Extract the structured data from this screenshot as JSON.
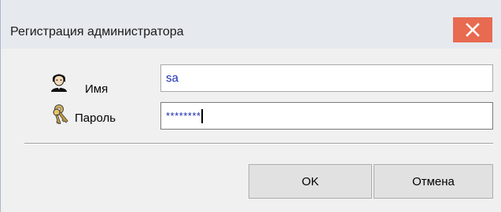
{
  "window": {
    "title": "Регистрация администратора"
  },
  "icons": {
    "close": "close-icon",
    "user": "user-icon",
    "key": "key-icon"
  },
  "form": {
    "name_label": "Имя",
    "name_value": "sa",
    "password_label": "Пароль",
    "password_value": "********"
  },
  "buttons": {
    "ok_label": "OK",
    "cancel_label": "Отмена"
  },
  "colors": {
    "close_button": "#e86a50",
    "input_text": "#1a2bb0"
  }
}
